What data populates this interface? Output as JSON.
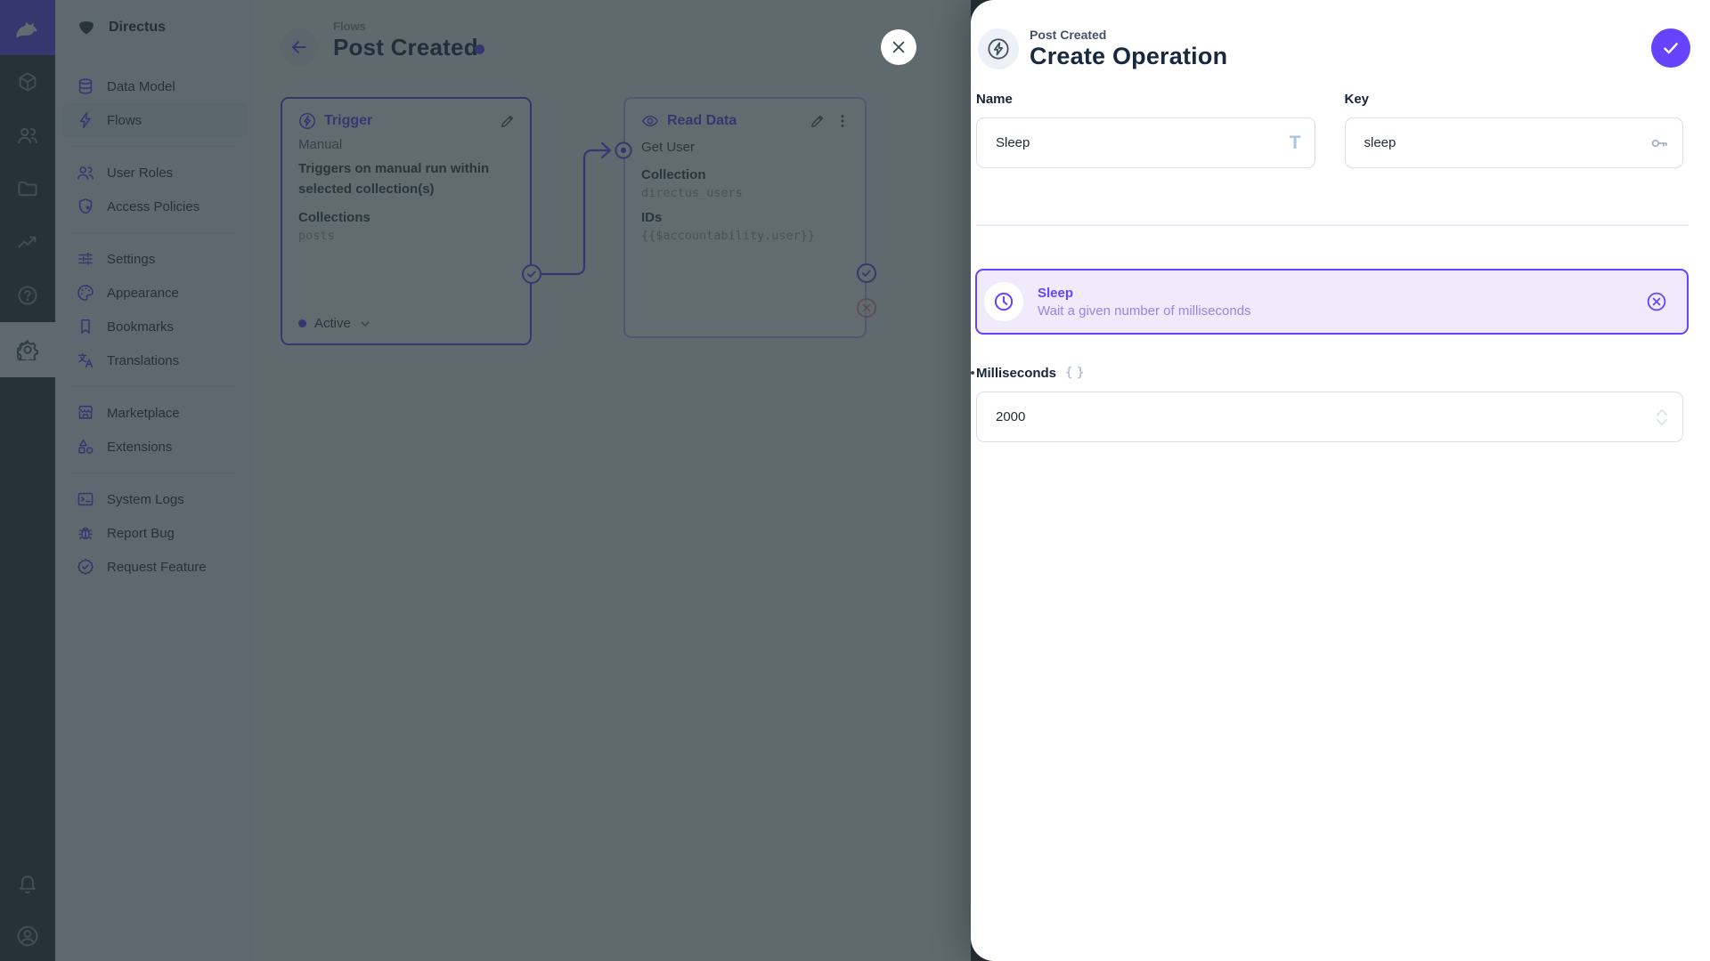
{
  "colors": {
    "accent": "#6644FF",
    "danger": "#E35169",
    "heading": "#172940",
    "backdrop": "rgba(37,50,56,0.72)"
  },
  "module_bar": {
    "logo_icon": "directus-rabbit-icon",
    "modules": [
      {
        "name": "content",
        "icon": "box-icon"
      },
      {
        "name": "users",
        "icon": "users-icon"
      },
      {
        "name": "files",
        "icon": "folder-icon"
      },
      {
        "name": "insights",
        "icon": "activity-icon"
      },
      {
        "name": "docs",
        "icon": "help-icon"
      },
      {
        "name": "settings",
        "icon": "gear-icon",
        "active": true
      }
    ],
    "bottom_icons": [
      "bell-icon",
      "account-circle-icon"
    ]
  },
  "sidebar": {
    "project_name": "Directus",
    "items": [
      {
        "label": "Data Model",
        "icon": "database-icon"
      },
      {
        "label": "Flows",
        "icon": "bolt-icon",
        "active": true
      },
      {
        "label": "User Roles",
        "icon": "users-icon"
      },
      {
        "label": "Access Policies",
        "icon": "shield-lock-icon"
      },
      {
        "label": "Settings",
        "icon": "tune-icon"
      },
      {
        "label": "Appearance",
        "icon": "palette-icon"
      },
      {
        "label": "Bookmarks",
        "icon": "bookmark-icon"
      },
      {
        "label": "Translations",
        "icon": "translate-icon"
      },
      {
        "label": "Marketplace",
        "icon": "storefront-icon"
      },
      {
        "label": "Extensions",
        "icon": "category-icon"
      },
      {
        "label": "System Logs",
        "icon": "terminal-icon"
      },
      {
        "label": "Report Bug",
        "icon": "bug-icon"
      },
      {
        "label": "Request Feature",
        "icon": "badge-icon"
      }
    ]
  },
  "canvas": {
    "breadcrumb": "Flows",
    "title": "Post Created",
    "trigger_card": {
      "title": "Trigger",
      "type": "Manual",
      "description": "Triggers on manual run within selected collection(s)",
      "collections_label": "Collections",
      "collections_value": "posts",
      "status": "Active"
    },
    "operation_card": {
      "title": "Read Data",
      "name": "Get User",
      "collection_label": "Collection",
      "collection_value": "directus_users",
      "ids_label": "IDs",
      "ids_value": "{{$accountability.user}}"
    }
  },
  "drawer": {
    "breadcrumb": "Post Created",
    "title": "Create Operation",
    "name_field": {
      "label": "Name",
      "value": "Sleep"
    },
    "key_field": {
      "label": "Key",
      "value": "sleep"
    },
    "selected_operation": {
      "name": "Sleep",
      "description": "Wait a given number of milliseconds"
    },
    "milliseconds_field": {
      "label": "Milliseconds",
      "value": "2000"
    }
  }
}
